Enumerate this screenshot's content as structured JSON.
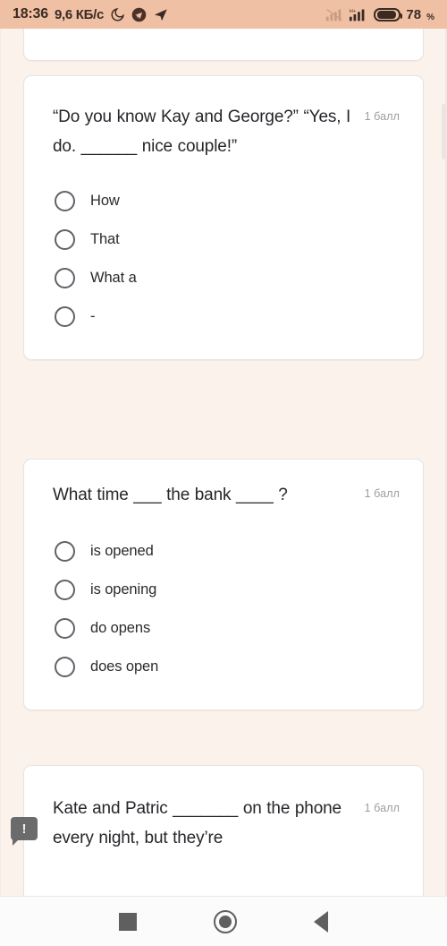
{
  "statusbar": {
    "time": "18:36",
    "data_rate": "9,6 КБ/с",
    "battery_percent": "78",
    "percent_symbol": "%",
    "icons": [
      "moon-icon",
      "telegram-icon",
      "send-icon",
      "signal-icon",
      "signal-icon-2",
      "battery-icon"
    ]
  },
  "questions": [
    {
      "text": "“Do you know Kay and George?” “Yes, I do. ______ nice couple!”",
      "points": "1 балл",
      "options": [
        "How",
        "That",
        "What a",
        "-"
      ]
    },
    {
      "text": "What time ___ the bank ____ ?",
      "points": "1 балл",
      "options": [
        "is opened",
        "is opening",
        "do opens",
        "does open"
      ]
    },
    {
      "text": "Kate and Patric _______ on the phone every night, but they’re",
      "points": "1 балл",
      "options": []
    }
  ],
  "feedback_badge": "!",
  "navbar": {
    "recents": "recents-square",
    "home": "home-circle",
    "back": "back-triangle"
  },
  "colors": {
    "statusbar_bg": "#f0c0a4",
    "page_bg": "#fbf2ec",
    "card_bg": "#ffffff",
    "text": "#26262b",
    "muted": "#9d9d9d"
  }
}
